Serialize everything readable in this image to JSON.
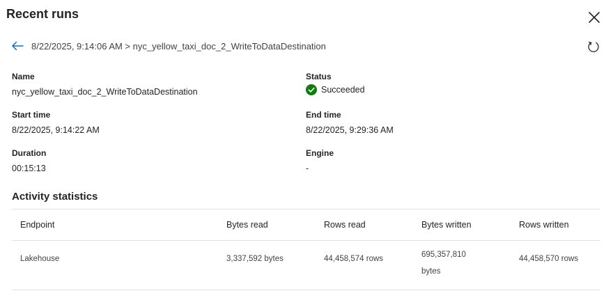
{
  "header": {
    "title": "Recent runs"
  },
  "breadcrumb": {
    "text": "8/22/2025, 9:14:06 AM > nyc_yellow_taxi_doc_2_WriteToDataDestination"
  },
  "details": {
    "name_label": "Name",
    "name_value": "nyc_yellow_taxi_doc_2_WriteToDataDestination",
    "status_label": "Status",
    "status_value": "Succeeded",
    "start_time_label": "Start time",
    "start_time_value": "8/22/2025, 9:14:22 AM",
    "end_time_label": "End time",
    "end_time_value": "8/22/2025, 9:29:36 AM",
    "duration_label": "Duration",
    "duration_value": "00:15:13",
    "engine_label": "Engine",
    "engine_value": "-"
  },
  "activity": {
    "title": "Activity statistics",
    "columns": [
      "Endpoint",
      "Bytes read",
      "Rows read",
      "Bytes written",
      "Rows written"
    ],
    "rows": [
      {
        "endpoint": "Lakehouse",
        "bytes_read": "3,337,592 bytes",
        "rows_read": "44,458,574 rows",
        "bytes_written": "695,357,810 bytes",
        "rows_written": "44,458,570 rows"
      }
    ]
  },
  "icons": {
    "close": "close-icon",
    "back": "arrow-left-icon",
    "refresh": "refresh-icon",
    "status": "checkmark-circle-icon"
  },
  "colors": {
    "accent": "#0f6cbd",
    "success": "#107c10",
    "text": "#242424"
  }
}
